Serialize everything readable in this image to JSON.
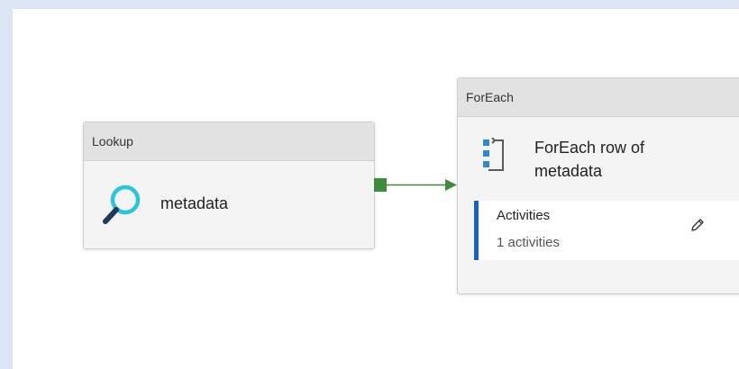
{
  "lookup_activity": {
    "type_label": "Lookup",
    "name": "metadata",
    "icon": "magnifier-icon"
  },
  "foreach_activity": {
    "type_label": "ForEach",
    "name": "ForEach row of metadata",
    "icon": "foreach-loop-icon",
    "activities_title": "Activities",
    "activities_count": "1 activities",
    "edit_icon": "pencil-icon"
  },
  "connector": {
    "kind": "success-dependency-arrow",
    "color": "#3d8b3d"
  },
  "colors": {
    "background": "#dbe5f4",
    "canvas": "#ffffff",
    "accent": "#1565c0",
    "lookup_icon": "#2bc4dd",
    "foreach_icon": "#2f86d1"
  }
}
